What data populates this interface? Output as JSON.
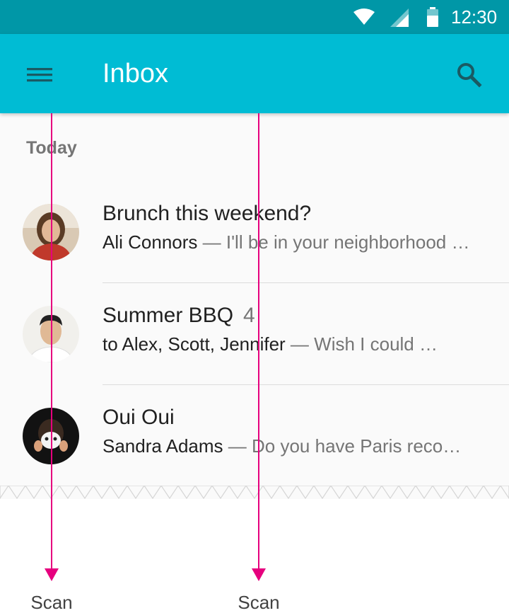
{
  "status_bar": {
    "time": "12:30",
    "icons": [
      "wifi-icon",
      "cell-signal-icon",
      "battery-icon"
    ]
  },
  "app_bar": {
    "title": "Inbox",
    "menu_icon": "menu-icon",
    "search_icon": "search-icon",
    "color": "#00bcd4",
    "status_color": "#0097a7"
  },
  "list": {
    "section": "Today",
    "items": [
      {
        "title": "Brunch this weekend?",
        "count": "",
        "sender": "Ali Connors",
        "dash": " — ",
        "preview": "I'll be in your neighborhood …"
      },
      {
        "title": "Summer BBQ",
        "count": "4",
        "sender": "to Alex, Scott, Jennifer",
        "dash": " — ",
        "preview": "Wish I could …"
      },
      {
        "title": "Oui Oui",
        "count": "",
        "sender": "Sandra Adams",
        "dash": " — ",
        "preview": "Do you have Paris reco…"
      }
    ]
  },
  "annotations": {
    "scan_left": "Scan",
    "scan_right": "Scan",
    "line_color": "#e6007e"
  }
}
